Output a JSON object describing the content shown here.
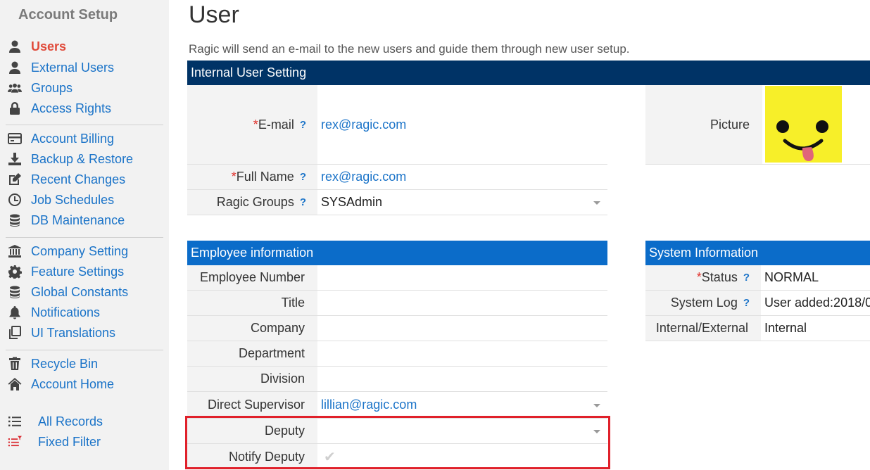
{
  "sidebar": {
    "title": "Account Setup",
    "groups": [
      [
        {
          "label": "Users",
          "icon": "user-icon",
          "active": true
        },
        {
          "label": "External Users",
          "icon": "user-icon"
        },
        {
          "label": "Groups",
          "icon": "users-group-icon"
        },
        {
          "label": "Access Rights",
          "icon": "lock-icon"
        }
      ],
      [
        {
          "label": "Account Billing",
          "icon": "billing-icon"
        },
        {
          "label": "Backup & Restore",
          "icon": "download-icon"
        },
        {
          "label": "Recent Changes",
          "icon": "edit-icon"
        },
        {
          "label": "Job Schedules",
          "icon": "clock-icon"
        },
        {
          "label": "DB Maintenance",
          "icon": "database-icon"
        }
      ],
      [
        {
          "label": "Company Setting",
          "icon": "bank-icon"
        },
        {
          "label": "Feature Settings",
          "icon": "gear-icon"
        },
        {
          "label": "Global Constants",
          "icon": "database-icon"
        },
        {
          "label": "Notifications",
          "icon": "bell-icon"
        },
        {
          "label": "UI Translations",
          "icon": "copy-icon"
        }
      ],
      [
        {
          "label": "Recycle Bin",
          "icon": "trash-icon"
        },
        {
          "label": "Account Home",
          "icon": "home-icon"
        }
      ]
    ],
    "records": [
      {
        "label": "All Records",
        "icon": "list-icon"
      },
      {
        "label": "Fixed Filter",
        "icon": "filter-list-icon"
      }
    ]
  },
  "page": {
    "title": "User",
    "description": "Ragic will send an e-mail to the new users and guide them through new user setup."
  },
  "internal_user_setting": {
    "header": "Internal User Setting",
    "email_label": "E-mail",
    "email_value": "rex@ragic.com",
    "full_name_label": "Full Name",
    "full_name_value": "rex@ragic.com",
    "groups_label": "Ragic Groups",
    "groups_value": "SYSAdmin",
    "picture_label": "Picture",
    "required_mark": "*",
    "help_mark": "?"
  },
  "employee_information": {
    "header": "Employee information",
    "fields": [
      {
        "label": "Employee Number",
        "value": ""
      },
      {
        "label": "Title",
        "value": ""
      },
      {
        "label": "Company",
        "value": ""
      },
      {
        "label": "Department",
        "value": ""
      },
      {
        "label": "Division",
        "value": ""
      },
      {
        "label": "Direct Supervisor",
        "value": "lillian@ragic.com"
      },
      {
        "label": "Deputy",
        "value": ""
      },
      {
        "label": "Notify Deputy",
        "value": ""
      }
    ],
    "check_glyph": "✔"
  },
  "system_information": {
    "header": "System Information",
    "status_label": "Status",
    "status_value": "NORMAL",
    "log_label": "System Log",
    "log_value": "User added:2018/0",
    "type_label": "Internal/External",
    "type_value": "Internal"
  },
  "colors": {
    "header_dark": "#003366",
    "header_blue": "#0b6cc9",
    "link": "#1a73c8",
    "active_nav": "#e04a3a",
    "highlight": "#e0202a",
    "avatar_bg": "#f7ef29"
  }
}
